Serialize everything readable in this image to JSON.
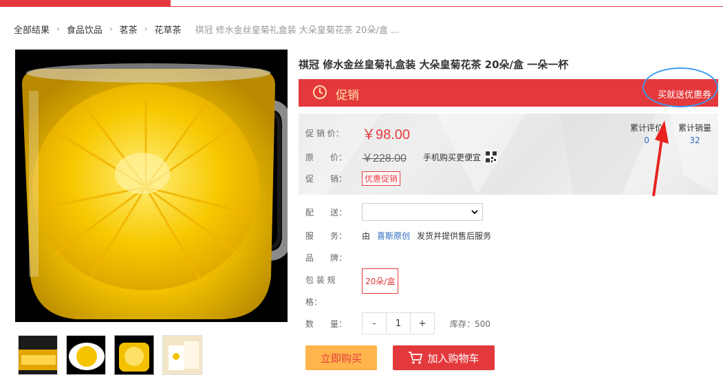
{
  "breadcrumb": {
    "items": [
      "全部结果",
      "食品饮品",
      "茗茶",
      "花草茶"
    ],
    "current": "祺冠 修水金丝皇菊礼盒装 大朵皇菊花茶 20朵/盒 ..."
  },
  "product": {
    "title": "祺冠 修水金丝皇菊礼盒装 大朵皇菊花茶 20朵/盒 一朵一杯"
  },
  "promo_bar": {
    "label": "促销",
    "right_text": "买就送优惠券",
    "icon": "clock-icon"
  },
  "price_panel": {
    "sale_label": "促 销 价：",
    "sale_price": "￥98.00",
    "original_label": "原　　价：",
    "original_price": "￥228.00",
    "mobile_text": "手机购买更便宜",
    "promo_label": "促　　销：",
    "promo_tag": "优惠促销",
    "reviews_label": "累计评价",
    "reviews_count": "0",
    "sales_label": "累计销量",
    "sales_count": "32"
  },
  "details": {
    "delivery_label": "配　　送：",
    "service_label": "服　　务：",
    "service_prefix": "由",
    "service_store": "喜斯原创",
    "service_suffix": "发货并提供售后服务",
    "brand_label": "品　　牌：",
    "spec_label_1": "包 装 规",
    "spec_label_2": "格：",
    "spec_option": "20朵/盒",
    "qty_label": "数　　量：",
    "qty_minus": "-",
    "qty_value": "1",
    "qty_plus": "+",
    "stock_text": "库存：500"
  },
  "actions": {
    "buy_now": "立即购买",
    "add_to_cart": "加入购物车"
  },
  "colors": {
    "brand_red": "#e4393c",
    "promo_gold": "#fce1a6",
    "buy_orange": "#ffb44c",
    "link_blue": "#2b6ac0",
    "annotation_blue": "#3b9af1"
  }
}
